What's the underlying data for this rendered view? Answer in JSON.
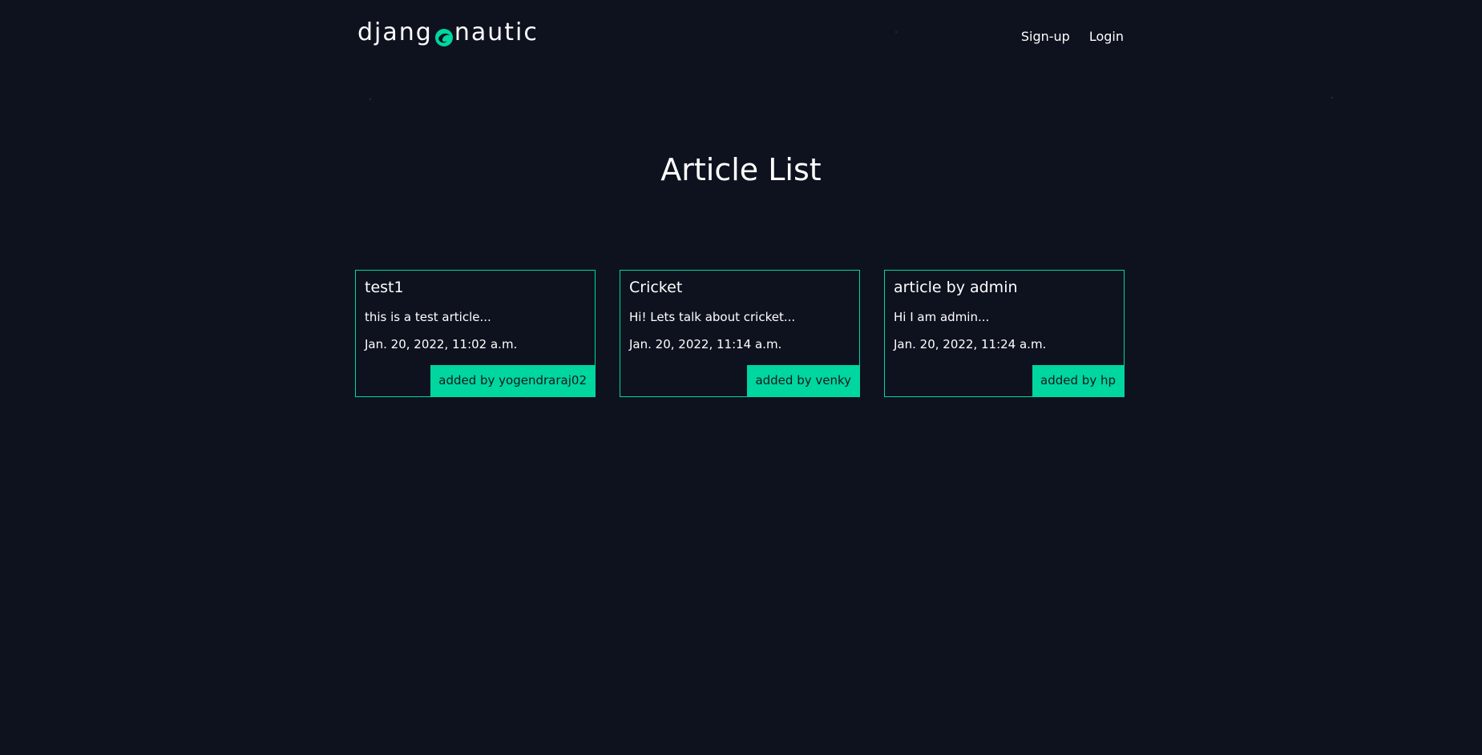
{
  "brand": {
    "prefix": "djang",
    "suffix": "nautic",
    "logo_icon": "django-swirl-icon",
    "accent_color": "#00d6a0",
    "background_color": "#0e121e"
  },
  "nav": {
    "signup_label": "Sign-up",
    "login_label": "Login"
  },
  "page": {
    "title": "Article List"
  },
  "articles": [
    {
      "title": "test1",
      "excerpt": "this is a test article...",
      "date": "Jan. 20, 2022, 11:02 a.m.",
      "author": "added by yogendraraj02"
    },
    {
      "title": "Cricket",
      "excerpt": "Hi! Lets talk about cricket...",
      "date": "Jan. 20, 2022, 11:14 a.m.",
      "author": "added by venky"
    },
    {
      "title": "article by admin",
      "excerpt": "Hi I am admin...",
      "date": "Jan. 20, 2022, 11:24 a.m.",
      "author": "added by hp"
    }
  ]
}
